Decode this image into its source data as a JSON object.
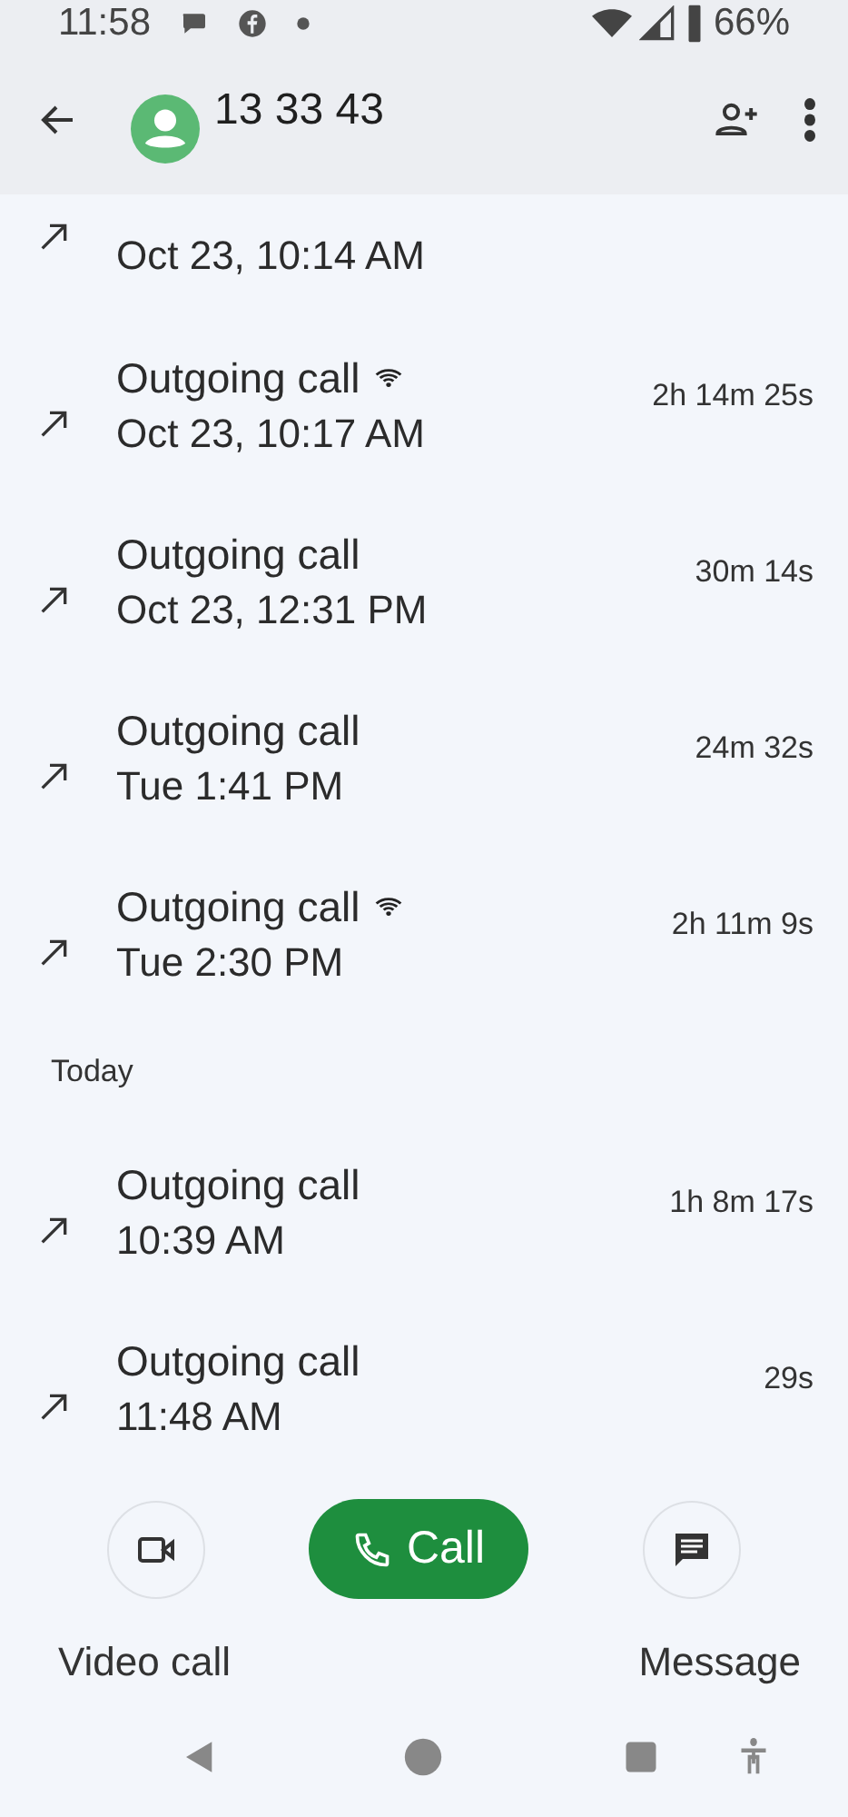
{
  "status_bar": {
    "time": "11:58",
    "battery": "66%"
  },
  "header": {
    "title": "13 33 43"
  },
  "items": [
    {
      "kind": "partial",
      "date": "Oct 23, 10:14 AM"
    },
    {
      "kind": "call",
      "title": "Outgoing call",
      "wifi": true,
      "date": "Oct 23, 10:17 AM",
      "duration": "2h 14m 25s"
    },
    {
      "kind": "call",
      "title": "Outgoing call",
      "wifi": false,
      "date": "Oct 23, 12:31 PM",
      "duration": "30m 14s"
    },
    {
      "kind": "call",
      "title": "Outgoing call",
      "wifi": false,
      "date": "Tue 1:41 PM",
      "duration": "24m 32s"
    },
    {
      "kind": "call",
      "title": "Outgoing call",
      "wifi": true,
      "date": "Tue 2:30 PM",
      "duration": "2h 11m 9s"
    },
    {
      "kind": "header",
      "label": "Today"
    },
    {
      "kind": "call",
      "title": "Outgoing call",
      "wifi": false,
      "date": "10:39 AM",
      "duration": "1h 8m 17s"
    },
    {
      "kind": "call",
      "title": "Outgoing call",
      "wifi": false,
      "date": "11:48 AM",
      "duration": "29s"
    }
  ],
  "actions": {
    "video_label": "Video call",
    "call_label": "Call",
    "message_label": "Message"
  }
}
